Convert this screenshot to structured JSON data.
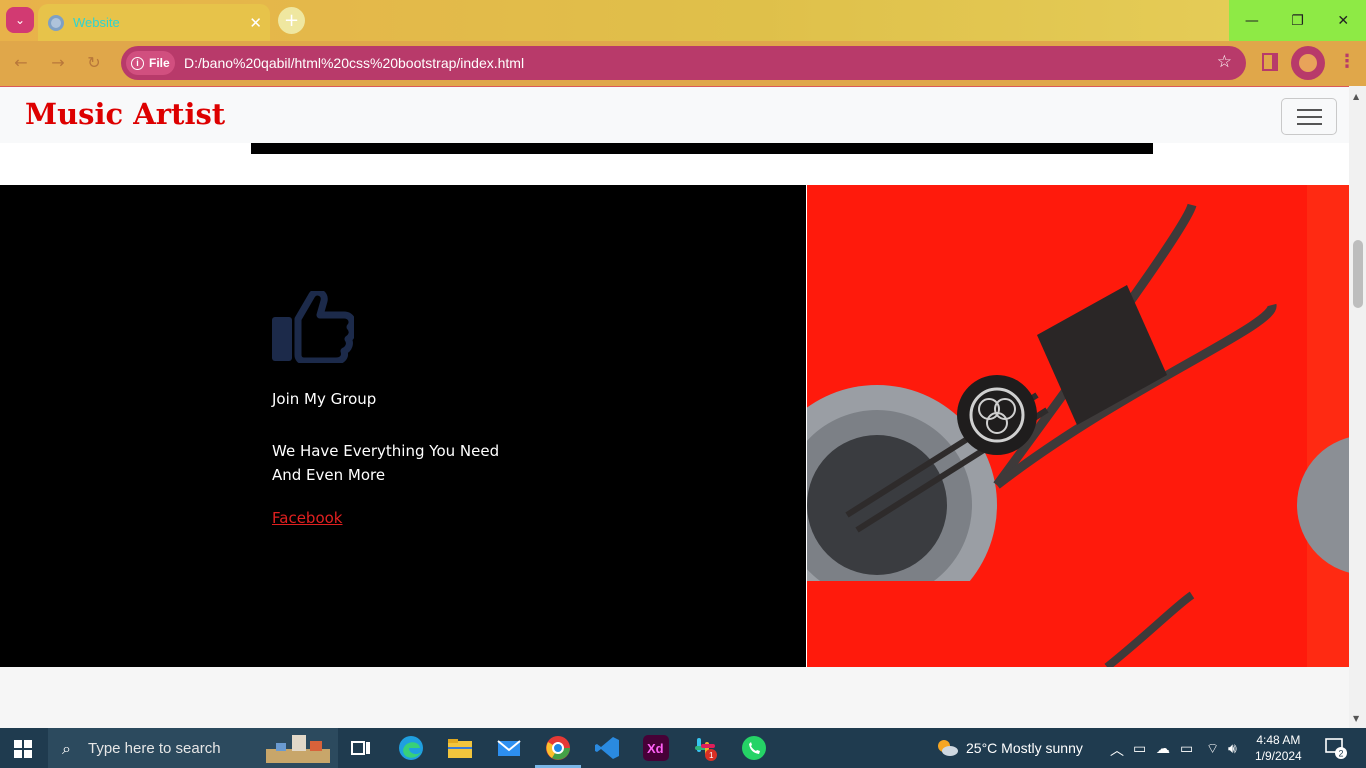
{
  "browser": {
    "tab_title": "Website",
    "tab_close": "✕",
    "new_tab": "+",
    "chip_label": "File",
    "url": "D:/bano%20qabil/html%20css%20bootstrap/index.html"
  },
  "page": {
    "brand": "Music Artist",
    "feature": {
      "heading": "Join My Group",
      "description": "We Have Everything You Need And Even More",
      "link": "Facebook"
    }
  },
  "taskbar": {
    "search_placeholder": "Type here to search",
    "weather": "25°C  Mostly sunny",
    "time": "4:48 AM",
    "date": "1/9/2024",
    "notification_count": "2",
    "slack_badge": "1"
  }
}
